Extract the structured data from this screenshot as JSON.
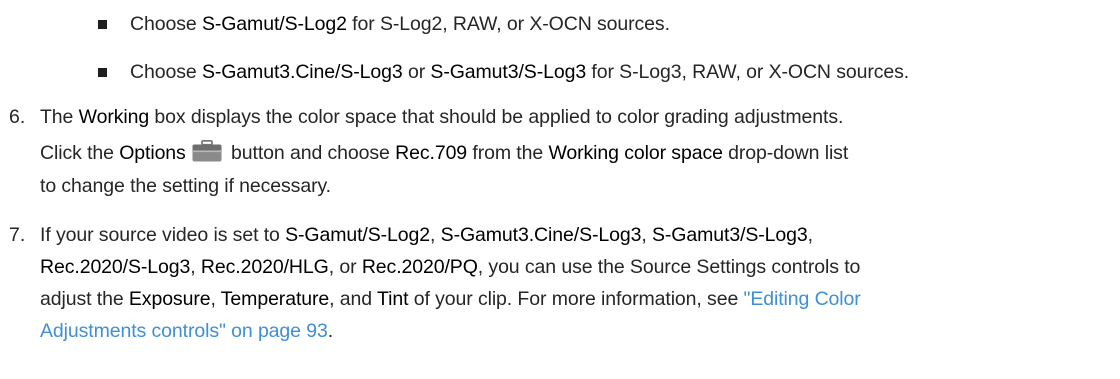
{
  "steps": [
    {
      "bullets": [
        {
          "pre": "Choose ",
          "ui1": "S-Gamut/S-Log2",
          "post": " for S-Log2, RAW, or X-OCN sources."
        },
        {
          "pre": "Choose ",
          "ui1": "S-Gamut3.Cine/S-Log3",
          "mid": " or ",
          "ui2": "S-Gamut3/S-Log3",
          "post": " for S-Log3, RAW, or X-OCN sources."
        }
      ]
    },
    {
      "number": "6.",
      "line1": {
        "pre": "The ",
        "ui1": "Working",
        "post": " box displays the color space that should be applied to color grading adjustments."
      },
      "line2": {
        "pre": "Click the ",
        "ui1": "Options",
        "mid": " button and choose ",
        "ui2": "Rec.709",
        "mid2": " from the ",
        "ui3": "Working color space",
        "post": " drop-down list"
      },
      "line3": "to change the setting if necessary.",
      "icon": "toolbox-icon"
    },
    {
      "number": "7.",
      "line1": {
        "t1": "If your source video is set to ",
        "u1": "S-Gamut/S-Log2",
        "t2": ", ",
        "u2": "S-Gamut3.Cine/S-Log3",
        "t3": ", ",
        "u3": "S-Gamut3/S-Log3",
        "t4": ","
      },
      "line2": {
        "u1": "Rec.2020/S-Log3",
        "t1": ", ",
        "u2": "Rec.2020/HLG",
        "t2": ", or ",
        "u3": "Rec.2020/PQ",
        "t3": ", you can use the Source Settings controls to"
      },
      "line3": {
        "t1": "adjust the ",
        "u1": "Exposure",
        "t2": ", ",
        "u2": "Temperature",
        "t3": ", and ",
        "u3": "Tint",
        "t4": " of your clip. For more information, see ",
        "link": "\"Editing Color"
      },
      "line4": {
        "link": "Adjustments controls\" on page 93",
        "t1": "."
      }
    }
  ],
  "colors": {
    "text": "#262626",
    "ui_term": "#000000",
    "link": "#3f8fd4",
    "icon": "#7a7a7a"
  }
}
